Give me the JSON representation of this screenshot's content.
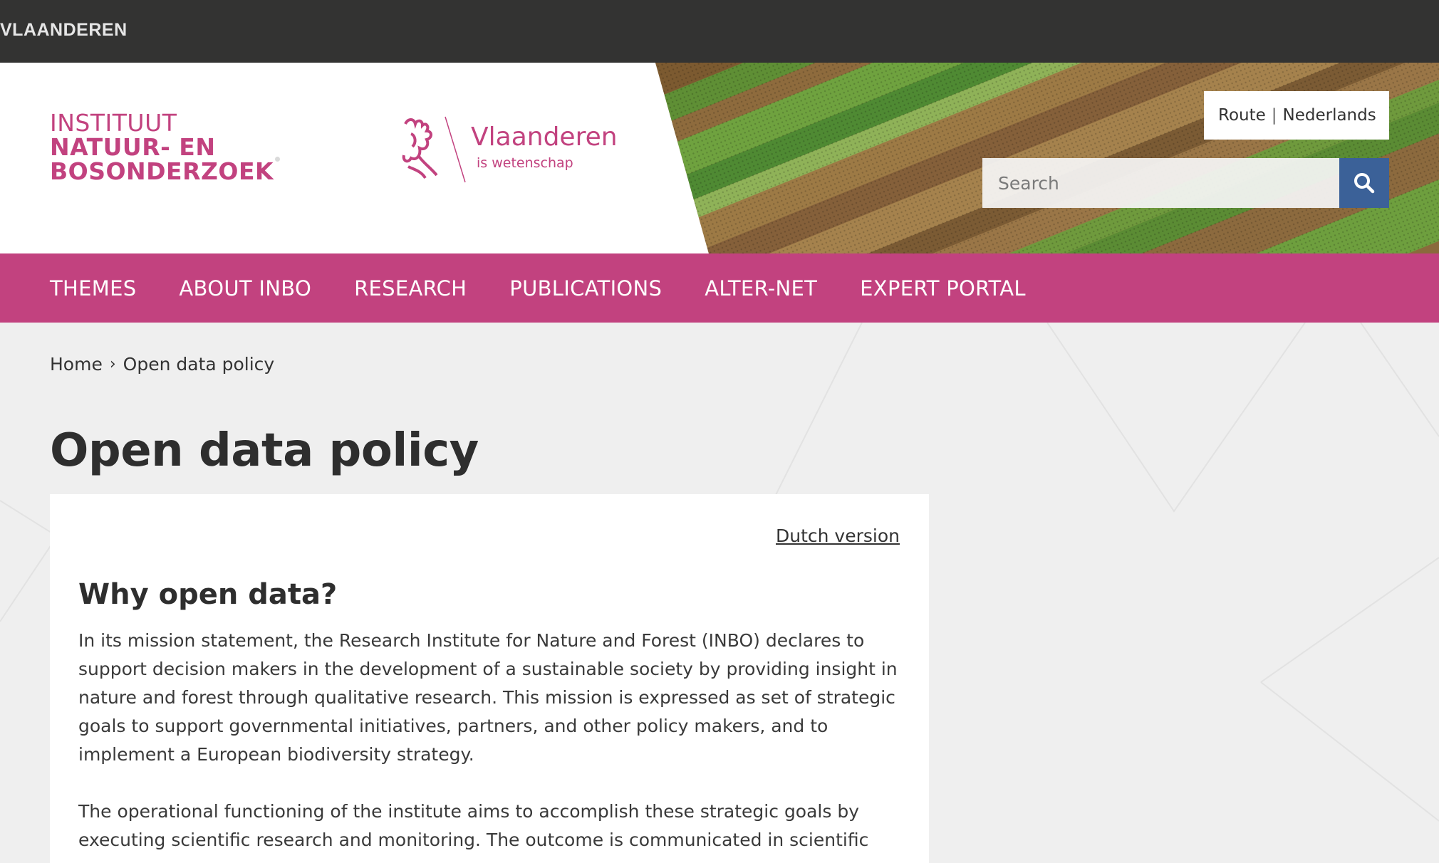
{
  "topbar": {
    "label": "VLAANDEREN"
  },
  "header": {
    "inbo_logo": {
      "line1": "INSTITUUT",
      "line2": "NATUUR- EN",
      "line3": "BOSONDERZOEK"
    },
    "vlaanderen_logo": {
      "name": "Vlaanderen",
      "tagline": "is wetenschap"
    },
    "utility": {
      "route": "Route",
      "language": "Nederlands"
    },
    "search": {
      "placeholder": "Search"
    }
  },
  "nav": {
    "items": [
      {
        "label": "THEMES"
      },
      {
        "label": "ABOUT INBO"
      },
      {
        "label": "RESEARCH"
      },
      {
        "label": "PUBLICATIONS"
      },
      {
        "label": "ALTER-NET"
      },
      {
        "label": "EXPERT PORTAL"
      }
    ]
  },
  "breadcrumb": {
    "home": "Home",
    "current": "Open data policy"
  },
  "page": {
    "title": "Open data policy",
    "dutch_link": "Dutch version",
    "section_heading": "Why open data?",
    "paragraphs": [
      "In its mission statement, the Research Institute for Nature and Forest (INBO) declares to support decision makers in the development of a sustainable society by providing insight in nature and forest through qualitative research. This mission is expressed as set of strategic goals to support governmental initiatives, partners, and other policy makers, and to implement a European biodiversity strategy.",
      "The operational functioning of the institute aims to accomplish these strategic goals by executing scientific research and monitoring. The outcome is communicated in scientific"
    ]
  },
  "colors": {
    "brand_pink": "#c2427f",
    "topbar": "#333332",
    "search_button": "#3b6198"
  },
  "icons": {
    "search": "search-icon",
    "lion": "vlaanderen-lion-logo",
    "chevron": "chevron-right-icon"
  }
}
